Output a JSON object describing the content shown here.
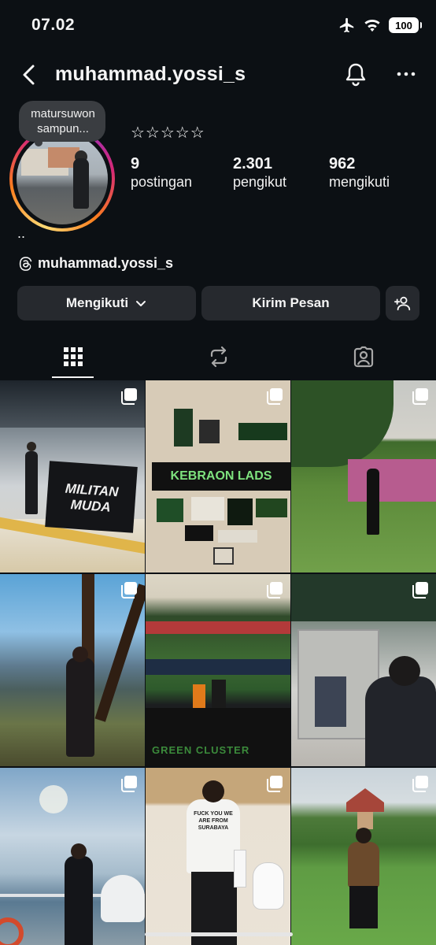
{
  "status_bar": {
    "time": "07.02",
    "battery": "100"
  },
  "header": {
    "username": "muhammad.yossi_s"
  },
  "profile": {
    "note": "matursuwon sampun...",
    "stars": "☆☆☆☆☆",
    "stats": [
      {
        "value": "9",
        "label": "postingan"
      },
      {
        "value": "2.301",
        "label": "pengikut"
      },
      {
        "value": "962",
        "label": "mengikuti"
      }
    ],
    "bio": "..",
    "threads_username": "muhammad.yossi_s"
  },
  "actions": {
    "following_label": "Mengikuti",
    "message_label": "Kirim Pesan"
  },
  "tabs": [
    {
      "name": "posts-grid",
      "icon": "grid-icon",
      "active": true
    },
    {
      "name": "reels",
      "icon": "repost-icon",
      "active": false
    },
    {
      "name": "tagged",
      "icon": "tagged-icon",
      "active": false
    }
  ],
  "posts": {
    "post_1": {
      "caption_text": "MILITAN MUDA",
      "carousel": true
    },
    "post_2": {
      "caption_text": "KEBRAON LADS",
      "carousel": true
    },
    "post_3": {
      "caption_text": "",
      "carousel": true
    },
    "post_4": {
      "caption_text": "",
      "carousel": true
    },
    "post_5": {
      "caption_text": "GREEN CLUSTER",
      "carousel": true
    },
    "post_6": {
      "caption_text": "",
      "carousel": true
    },
    "post_7": {
      "caption_text": "",
      "carousel": true
    },
    "post_8": {
      "caption_text": "FUCK YOU WE ARE FROM SURABAYA",
      "carousel": true
    },
    "post_9": {
      "caption_text": "",
      "carousel": true
    }
  },
  "colors": {
    "background": "#0c1014",
    "button": "#26292e",
    "text": "#f5f5f5"
  }
}
